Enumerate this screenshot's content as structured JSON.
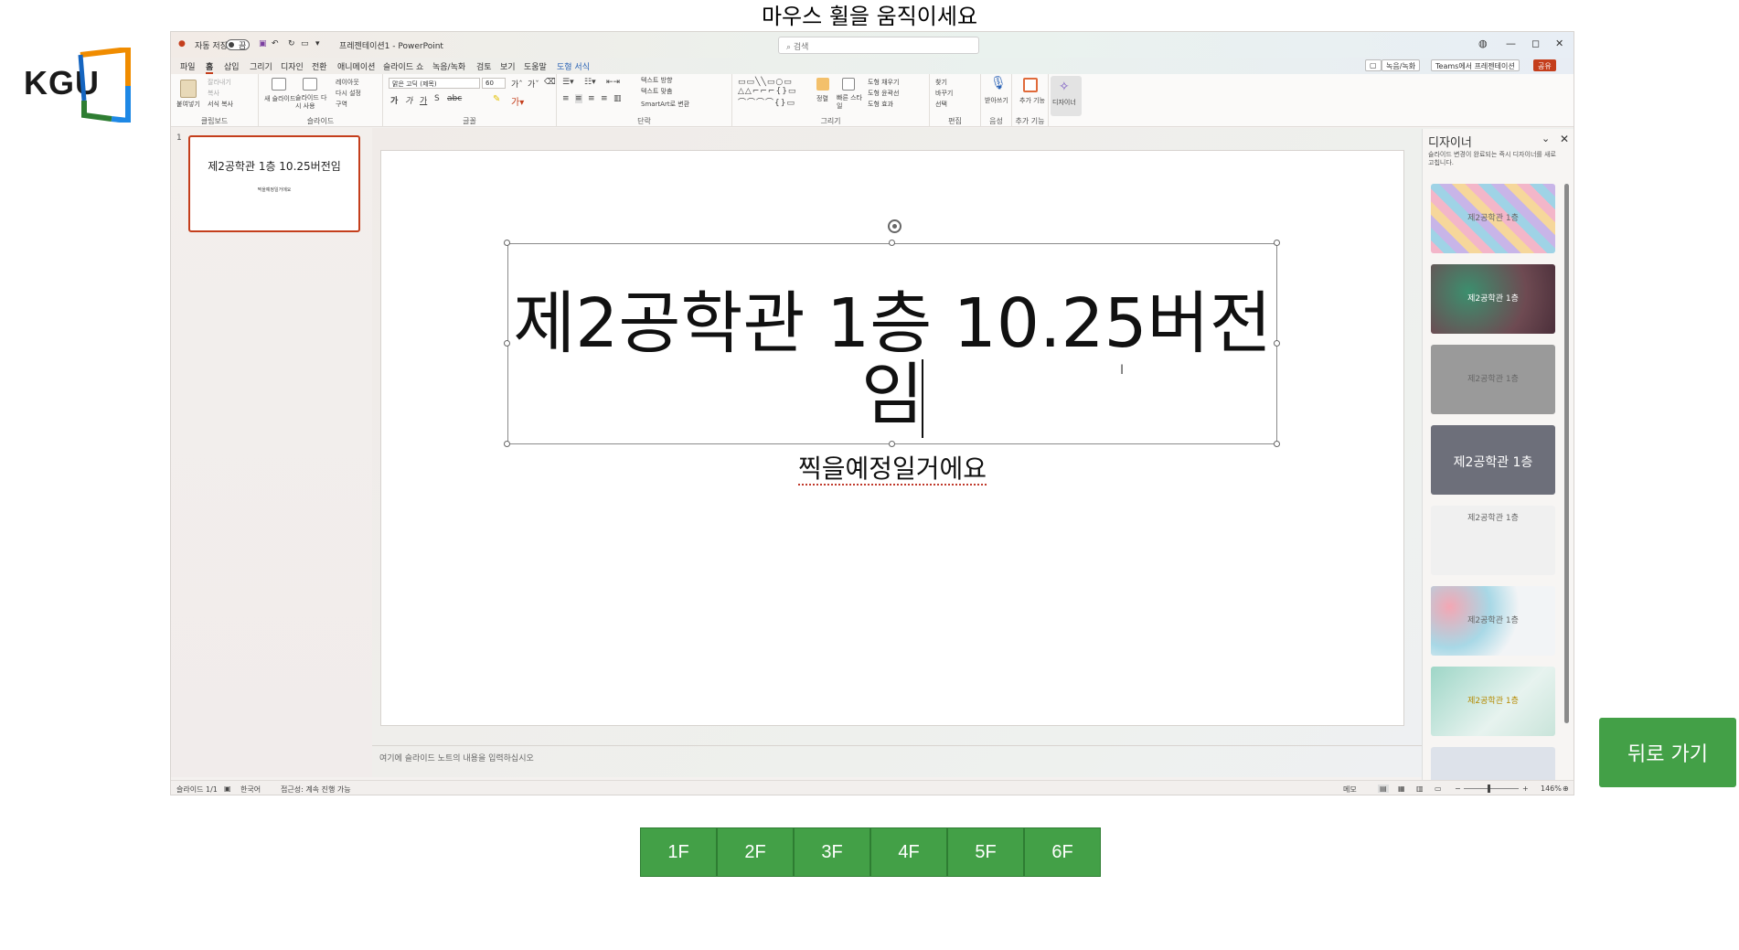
{
  "instruction": "마우스 휠을 움직이세요",
  "logo": {
    "text": "KGU"
  },
  "titlebar": {
    "autosave": "자동 저장",
    "autosave_state": "끔",
    "doc_title": "프레젠테이션1 - PowerPoint",
    "search_placeholder": "검색",
    "minimize": "—",
    "maximize": "◻",
    "close": "✕"
  },
  "menu": {
    "items": [
      "파일",
      "홈",
      "삽입",
      "그리기",
      "디자인",
      "전환",
      "애니메이션",
      "슬라이드 쇼",
      "녹음/녹화",
      "검토",
      "보기",
      "도움말",
      "도형 서식"
    ],
    "active_index": 1,
    "record": "녹음/녹화",
    "teams": "Teams에서 프레젠테이션",
    "share": "공유"
  },
  "ribbon": {
    "groups": [
      "클립보드",
      "슬라이드",
      "글꼴",
      "단락",
      "그리기",
      "편집",
      "음성",
      "추가 기능"
    ],
    "paste": "붙여넣기",
    "cut": "잘라내기",
    "copy": "복사",
    "format_painter": "서식 복사",
    "new_slide": "새 슬라이드",
    "reuse_slide": "슬라이드 다시 사용",
    "layout": "레이아웃",
    "reset": "다시 설정",
    "section": "구역",
    "font_name": "맑은 고딕 (제목)",
    "font_size": "60",
    "text_direction": "텍스트 방향",
    "align_text": "텍스트 맞춤",
    "smartart": "SmartArt로 변환",
    "arrange": "정렬",
    "quick_styles": "빠른 스타일",
    "shape_fill": "도형 채우기",
    "shape_outline": "도형 윤곽선",
    "shape_effects": "도형 효과",
    "find": "찾기",
    "replace": "바꾸기",
    "select": "선택",
    "dictate": "받아쓰기",
    "addins": "추가 기능",
    "designer": "디자이너"
  },
  "thumbnail": {
    "number": "1",
    "title": "제2공학관 1층 10.25버전임",
    "subtitle": "찍을예정일거에요"
  },
  "slide": {
    "title": "제2공학관 1층 10.25버전임",
    "subtitle": "찍을예정일거에요"
  },
  "notes": {
    "placeholder": "여기에 슬라이드 노트의 내용을 입력하십시오"
  },
  "designer": {
    "title": "디자이너",
    "description": "슬라이드 변경이 완료되는 즉시 디자이너를 새로 고칩니다.",
    "cards": [
      {
        "label": "제2공학관 1층",
        "bg": "#b9a6d6"
      },
      {
        "label": "제2공학관 1층",
        "bg": "#6e4a52"
      },
      {
        "label": "제2공학관 1층",
        "bg": "#9a9a9a"
      },
      {
        "label": "제2공학관 1층",
        "bg": "#6d6f7a"
      },
      {
        "label": "제2공학관 1층",
        "bg": "#f0f0f0"
      },
      {
        "label": "제2공학관 1층",
        "bg": "#e9eef3"
      },
      {
        "label": "제2공학관 1층",
        "bg": "#cfe6e0"
      },
      {
        "label": "",
        "bg": "#dde2ea"
      }
    ]
  },
  "statusbar": {
    "slide": "슬라이드 1/1",
    "lang": "한국어",
    "accessibility": "접근성: 계속 진행 가능",
    "notes": "메모",
    "zoom": "146%"
  },
  "floors": [
    "1F",
    "2F",
    "3F",
    "4F",
    "5F",
    "6F"
  ],
  "back_button": "뒤로 가기",
  "colors": {
    "accent": "#c43e1c",
    "button_green": "#43a047"
  }
}
